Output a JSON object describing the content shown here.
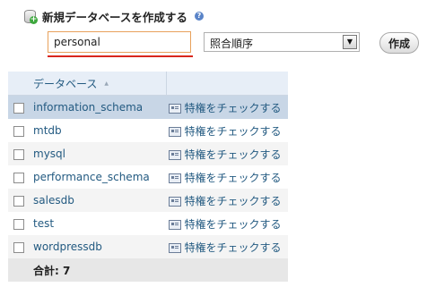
{
  "header": {
    "title": "新規データベースを作成する",
    "help_icon": "?"
  },
  "create_form": {
    "db_name_value": "personal",
    "collation_value": "照合順序",
    "create_button": "作成"
  },
  "table": {
    "column_header": "データベース",
    "rows": [
      {
        "name": "information_schema",
        "privileges": "特権をチェックする"
      },
      {
        "name": "mtdb",
        "privileges": "特権をチェックする"
      },
      {
        "name": "mysql",
        "privileges": "特権をチェックする"
      },
      {
        "name": "performance_schema",
        "privileges": "特権をチェックする"
      },
      {
        "name": "salesdb",
        "privileges": "特権をチェックする"
      },
      {
        "name": "test",
        "privileges": "特権をチェックする"
      },
      {
        "name": "wordpressdb",
        "privileges": "特権をチェックする"
      }
    ],
    "total_label": "合計: 7"
  },
  "colors": {
    "link": "#235a81",
    "header_bg": "#e7eef7",
    "highlight_row": "#c8d6e6",
    "input_border": "#e8a15b",
    "underline": "#d9261c"
  }
}
